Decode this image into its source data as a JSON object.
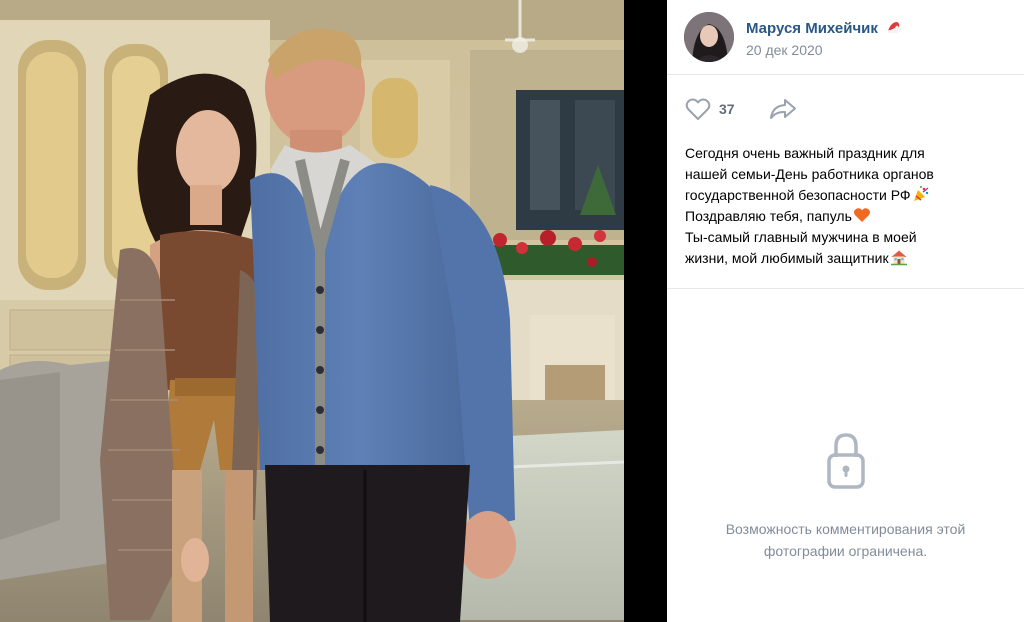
{
  "post": {
    "author_name": "Маруся Михейчик",
    "date": "20 дек 2020",
    "likes": "37",
    "caption_lines": [
      "Сегодня очень важный праздник для",
      "нашей семьи-День работника органов",
      "государственной безопасности РФ",
      "Поздравляю тебя, папуль",
      "Ты-самый главный мужчина в моей",
      "жизни, мой любимый защитник"
    ]
  },
  "comments": {
    "restricted_line1": "Возможность комментирования этой",
    "restricted_line2": "фотографии ограничена."
  },
  "icons": {
    "like": "heart-outline-icon",
    "share": "share-arrow-icon",
    "lock": "lock-icon",
    "name_badge": "santa-hat-icon",
    "caption_emojis": [
      "party-popper-icon",
      "orange-heart-icon",
      "house-icon"
    ]
  },
  "colors": {
    "link": "#2a5885",
    "muted": "#818c99",
    "icon": "#99a2ad"
  }
}
